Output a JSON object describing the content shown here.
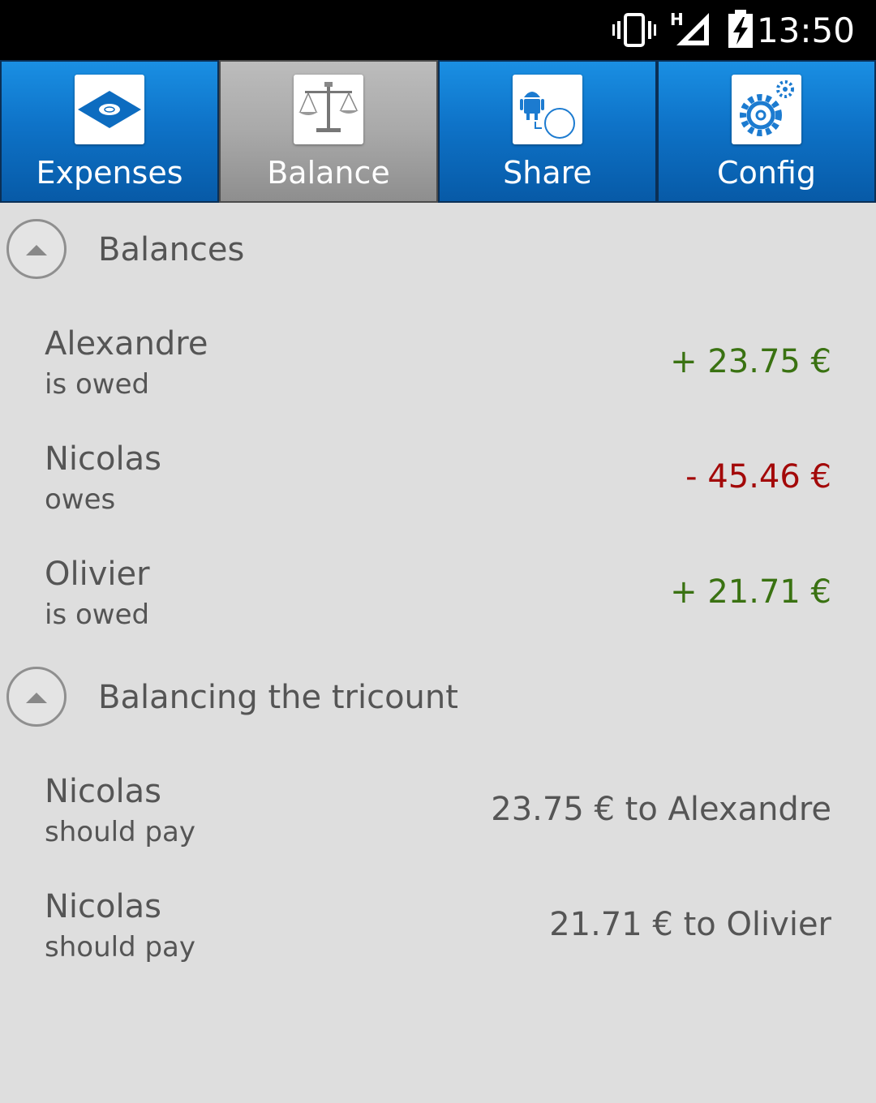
{
  "status_bar": {
    "time": "13:50",
    "network_label": "H",
    "icons": [
      "vibrate-icon",
      "signal-icon",
      "battery-charging-icon"
    ]
  },
  "tabs": [
    {
      "label": "Expenses",
      "icon": "expenses-icon",
      "active": false
    },
    {
      "label": "Balance",
      "icon": "balance-scale-icon",
      "active": true
    },
    {
      "label": "Share",
      "icon": "share-android-icon",
      "active": false
    },
    {
      "label": "Config",
      "icon": "gear-icon",
      "active": false
    }
  ],
  "balances": {
    "title": "Balances",
    "rows": [
      {
        "name": "Alexandre",
        "status": "is owed",
        "amount": "+ 23.75 €"
      },
      {
        "name": "Nicolas",
        "status": "owes",
        "amount": "- 45.46 €"
      },
      {
        "name": "Olivier",
        "status": "is owed",
        "amount": "+ 21.71 €"
      }
    ]
  },
  "balancing": {
    "title": "Balancing the tricount",
    "rows": [
      {
        "name": "Nicolas",
        "status": "should pay",
        "amount": "23.75 € to Alexandre"
      },
      {
        "name": "Nicolas",
        "status": "should pay",
        "amount": "21.71 € to Olivier"
      }
    ]
  },
  "colors": {
    "positive": "#3a7212",
    "negative": "#a30909",
    "tab_blue": "#0e73c8",
    "tab_active": "#a9a9a9"
  }
}
